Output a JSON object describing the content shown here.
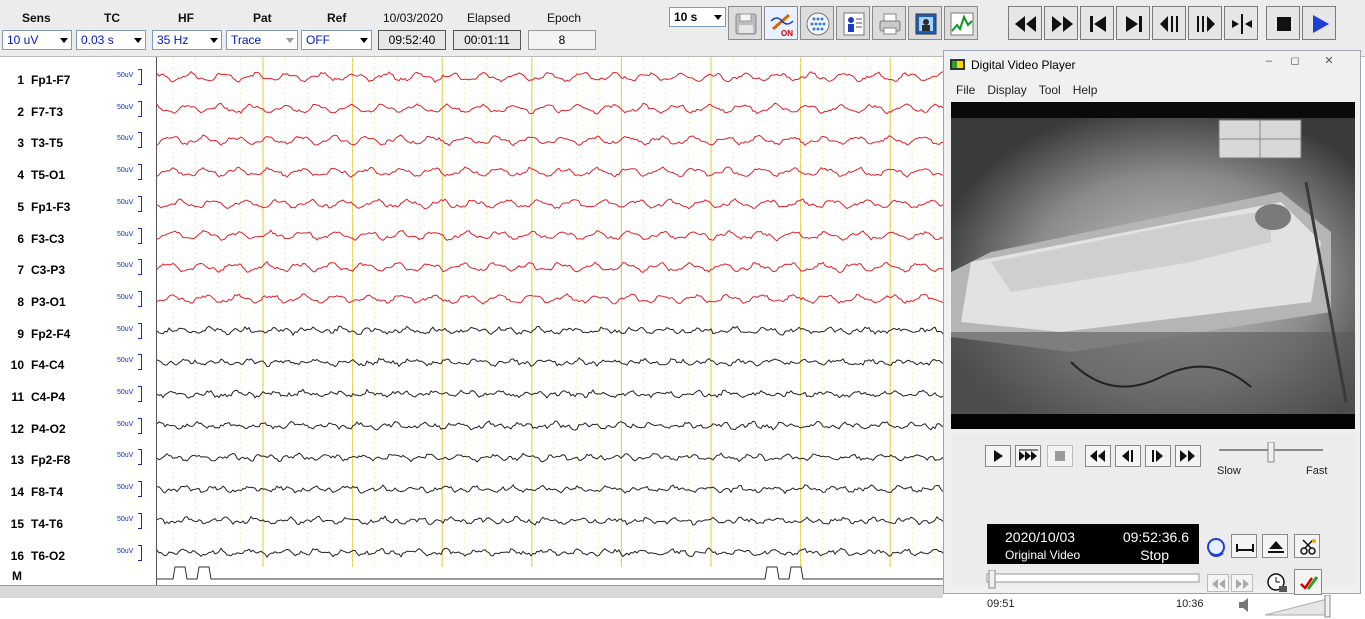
{
  "toolbar": {
    "headers": {
      "sens": "Sens",
      "tc": "TC",
      "hf": "HF",
      "pat": "Pat",
      "ref": "Ref",
      "date": "10/03/2020",
      "elapsed": "Elapsed",
      "epoch": "Epoch"
    },
    "sens_value": "10 uV",
    "tc_value": "0.03 s",
    "hf_value": "35 Hz",
    "pat_value": "Trace",
    "ref_value": "OFF",
    "time_value": "09:52:40",
    "elapsed_value": "00:01:11",
    "epoch_value": "8",
    "page_length": "10 s",
    "save_icon_text": "ON",
    "colors": {
      "accent": "#1e3fd6",
      "red_trace": "#e0202a"
    }
  },
  "eeg": {
    "channels": [
      {
        "num": "1",
        "name": "Fp1-F7",
        "cal": "50uV"
      },
      {
        "num": "2",
        "name": "F7-T3",
        "cal": "50uV"
      },
      {
        "num": "3",
        "name": "T3-T5",
        "cal": "50uV"
      },
      {
        "num": "4",
        "name": "T5-O1",
        "cal": "50uV"
      },
      {
        "num": "5",
        "name": "Fp1-F3",
        "cal": "50uV"
      },
      {
        "num": "6",
        "name": "F3-C3",
        "cal": "50uV"
      },
      {
        "num": "7",
        "name": "C3-P3",
        "cal": "50uV"
      },
      {
        "num": "8",
        "name": "P3-O1",
        "cal": "50uV"
      },
      {
        "num": "9",
        "name": "Fp2-F4",
        "cal": "50uV"
      },
      {
        "num": "10",
        "name": "F4-C4",
        "cal": "50uV"
      },
      {
        "num": "11",
        "name": "C4-P4",
        "cal": "50uV"
      },
      {
        "num": "12",
        "name": "P4-O2",
        "cal": "50uV"
      },
      {
        "num": "13",
        "name": "Fp2-F8",
        "cal": "50uV"
      },
      {
        "num": "14",
        "name": "F8-T4",
        "cal": "50uV"
      },
      {
        "num": "15",
        "name": "T4-T6",
        "cal": "50uV"
      },
      {
        "num": "16",
        "name": "T6-O2",
        "cal": "50uV"
      }
    ],
    "marker_label": "M"
  },
  "video_player": {
    "title": "Digital Video Player",
    "menu": [
      "File",
      "Display",
      "Tool",
      "Help"
    ],
    "speed_slow": "Slow",
    "speed_fast": "Fast",
    "date": "2020/10/03",
    "time": "09:52:36.6",
    "mode": "Original Video",
    "state": "Stop",
    "range_start": "09:51",
    "range_end": "10:36"
  }
}
